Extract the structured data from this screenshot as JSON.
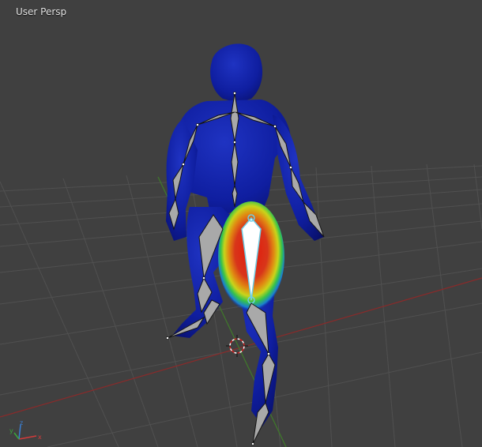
{
  "viewport": {
    "view_label": "User Persp",
    "colors": {
      "background": "#404040",
      "grid": "#505050",
      "x_axis": "#8a2a2a",
      "y_axis": "#3f7a2a",
      "mesh_base": "#0d1a8c",
      "bone_fill": "#a9a9a9",
      "active_bone_fill": "#ffffff",
      "active_bone_outline": "#6ecfe6",
      "weight_hot": "#e02010"
    },
    "gizmo": {
      "axis_x": "x",
      "axis_y": "y",
      "axis_z": "z"
    },
    "icons": [
      "3d-cursor-icon",
      "axis-gizmo-icon"
    ]
  }
}
